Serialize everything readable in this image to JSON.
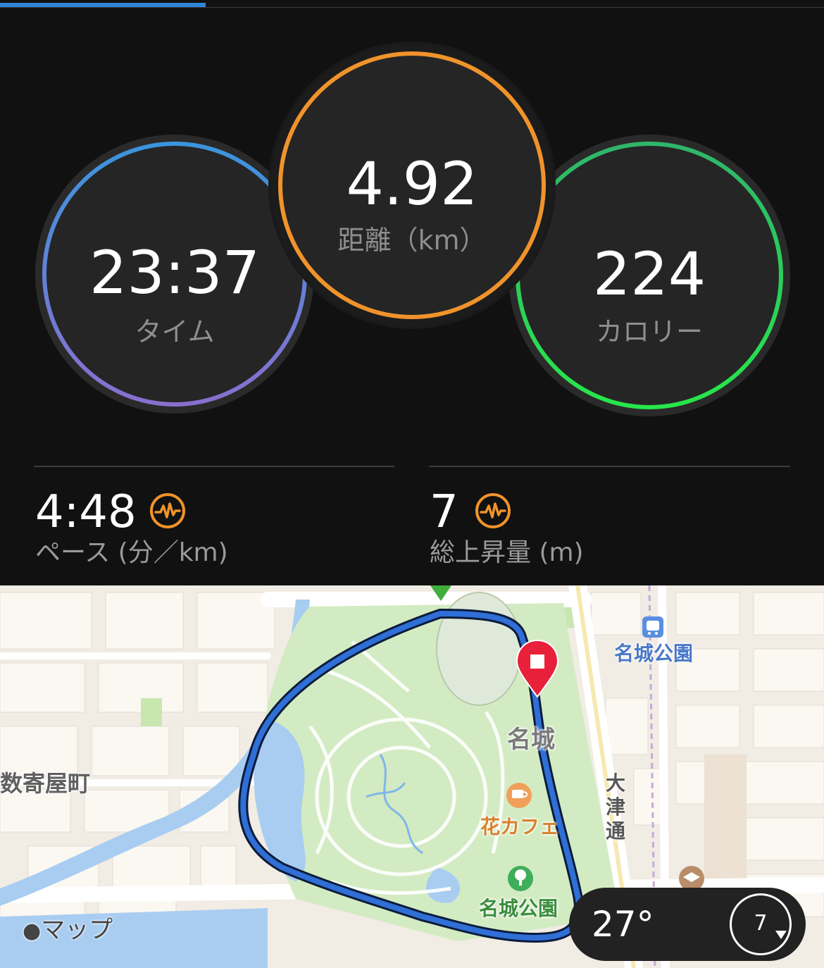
{
  "summary": {
    "distance": {
      "value": "4.92",
      "label": "距離（km）",
      "color": "#f0932b"
    },
    "time": {
      "value": "23:37",
      "label": "タイム",
      "color_top": "#3a95dd",
      "color_bottom": "#8a6fd0"
    },
    "calories": {
      "value": "224",
      "label": "カロリー",
      "color_top": "#2fb56a",
      "color_bottom": "#27e64a"
    }
  },
  "metrics": {
    "pace": {
      "value": "4:48",
      "label": "ペース (分／km)",
      "icon": "heart-rate-icon"
    },
    "elevation": {
      "value": "7",
      "label": "総上昇量 (m)",
      "icon": "heart-rate-icon"
    }
  },
  "map": {
    "labels": {
      "station": "名城公園",
      "area": "名城",
      "district": "数寄屋町",
      "street": "大津通",
      "cafe": "花カフェ",
      "park": "名城公園"
    },
    "attribution": "マップ",
    "route_color": "#2f6fd6",
    "end_marker_color": "#e8203a",
    "start_marker_color": "#3fae3a"
  },
  "weather": {
    "temperature": "27°",
    "wind_value": "7"
  }
}
